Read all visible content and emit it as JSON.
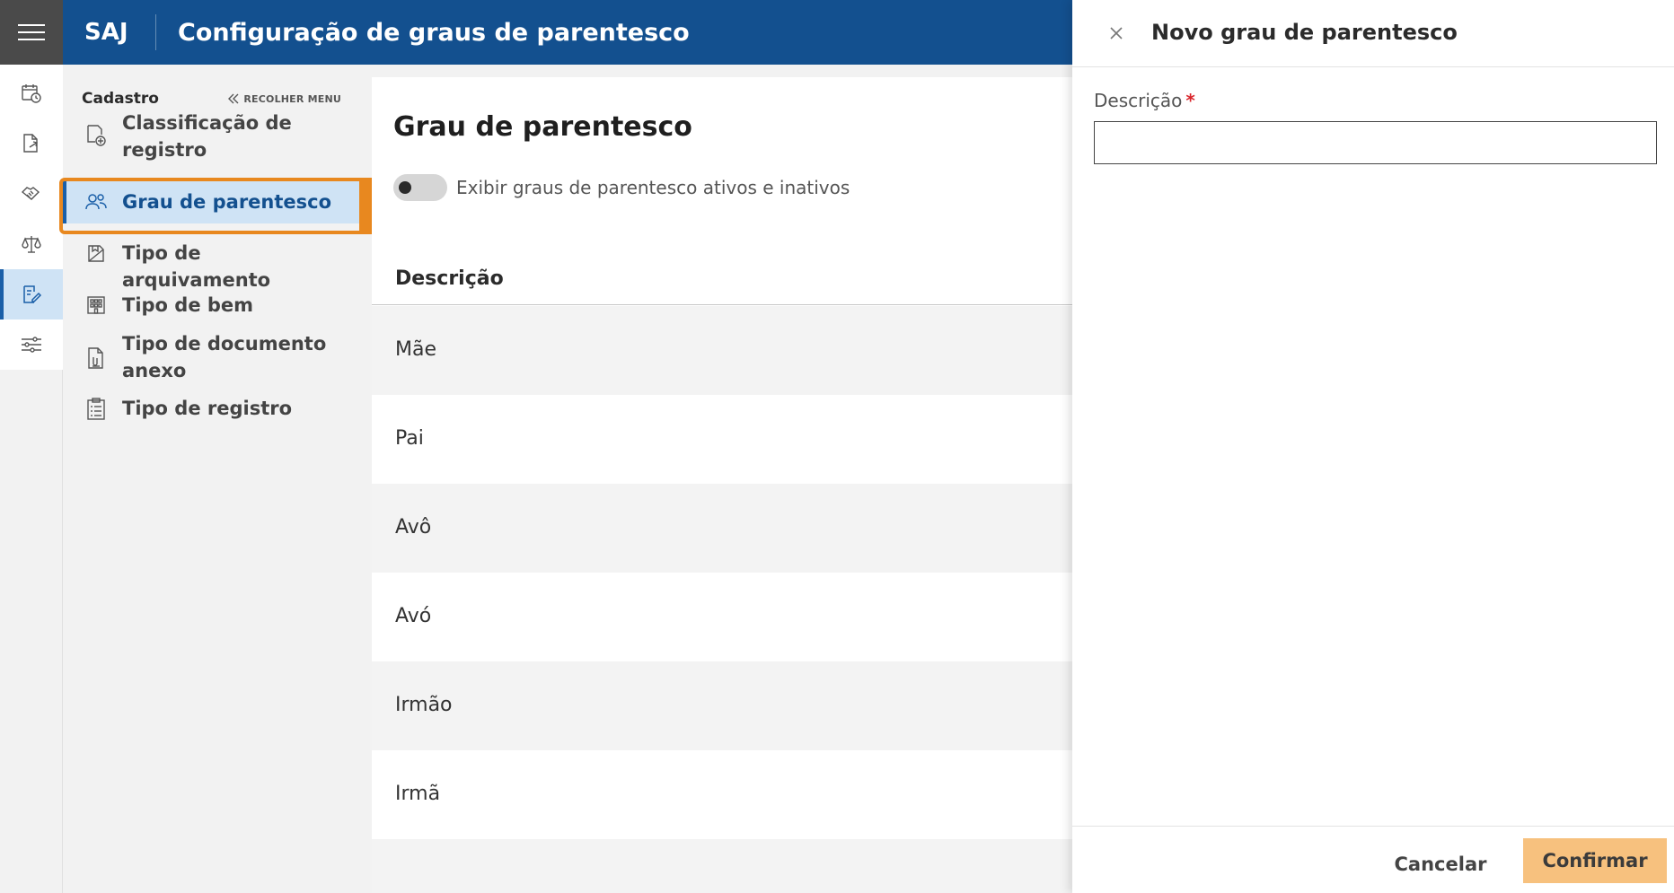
{
  "app": {
    "brand": "SAJ",
    "title": "Configuração de graus de parentesco"
  },
  "rail": {
    "items": [
      {
        "icon": "calendar-clock-icon"
      },
      {
        "icon": "document-share-icon"
      },
      {
        "icon": "handshake-icon"
      },
      {
        "icon": "scales-icon"
      },
      {
        "icon": "edit-document-icon",
        "active": true
      },
      {
        "icon": "sliders-icon"
      }
    ]
  },
  "submenu": {
    "title": "Cadastro",
    "collapse_label": "RECOLHER MENU",
    "items": [
      {
        "label": "Classificação de registro",
        "icon": "document-add-icon"
      },
      {
        "label": "Grau de parentesco",
        "icon": "people-icon",
        "selected": true
      },
      {
        "label": "Tipo de arquivamento",
        "icon": "archive-icon"
      },
      {
        "label": "Tipo de bem",
        "icon": "building-icon"
      },
      {
        "label": "Tipo de documento anexo",
        "icon": "document-attach-icon"
      },
      {
        "label": "Tipo de registro",
        "icon": "checklist-icon"
      }
    ]
  },
  "annotation": {
    "step": "1",
    "color": "#e8881f"
  },
  "main": {
    "title": "Grau de parentesco",
    "toggle_label": "Exibir graus de parentesco ativos e inativos",
    "toggle_on": false,
    "column_header": "Descrição",
    "rows": [
      "Mãe",
      "Pai",
      "Avô",
      "Avó",
      "Irmão",
      "Irmã"
    ]
  },
  "drawer": {
    "title": "Novo grau de parentesco",
    "field_label": "Descrição",
    "field_required_mark": "*",
    "field_value": "",
    "cancel_label": "Cancelar",
    "confirm_label": "Confirmar"
  },
  "colors": {
    "header": "#13508f",
    "accent": "#1a5fa8",
    "confirm": "#f7c17e",
    "selection": "#cfe3f5"
  }
}
